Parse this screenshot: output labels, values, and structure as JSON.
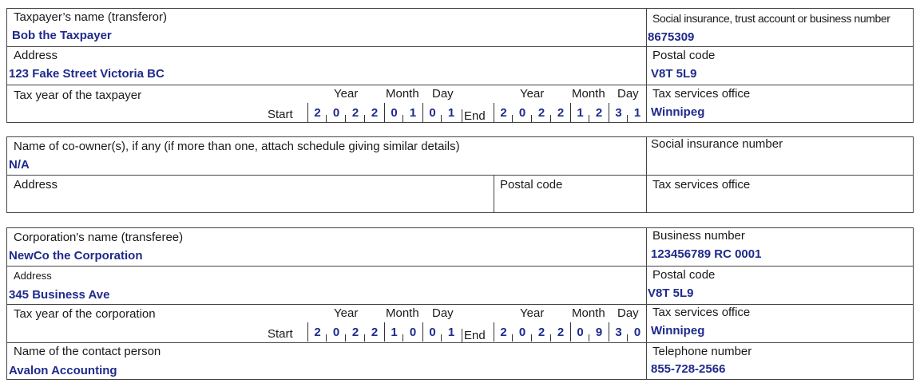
{
  "transferor": {
    "name_label": "Taxpayer’s name (transferor)",
    "name_value": "Bob the Taxpayer",
    "number_label": "Social insurance, trust account or business number",
    "number_value": "8675309",
    "address_label": "Address",
    "address_value": "123 Fake Street Victoria BC",
    "postal_label": "Postal code",
    "postal_value": "V8T 5L9",
    "tax_year_label": "Tax year of the taxpayer",
    "tso_label": "Tax services office",
    "tso_value": "Winnipeg",
    "year_label": "Year",
    "month_label": "Month",
    "day_label": "Day",
    "start_label": "Start",
    "end_label": "End",
    "start_digits": [
      "2",
      "0",
      "2",
      "2",
      "0",
      "1",
      "0",
      "1"
    ],
    "end_digits": [
      "2",
      "0",
      "2",
      "2",
      "1",
      "2",
      "3",
      "1"
    ]
  },
  "coowner": {
    "name_label": "Name of co-owner(s), if any (if more than one, attach schedule giving similar details)",
    "name_value": "N/A",
    "sin_label": "Social insurance number",
    "address_label": "Address",
    "postal_label": "Postal code",
    "tso_label": "Tax services office"
  },
  "transferee": {
    "name_label": "Corporation's name (transferee)",
    "name_value": "NewCo the Corporation",
    "bn_label": "Business number",
    "bn_value": "123456789 RC 0001",
    "address_label": "Address",
    "address_value": "345 Business Ave",
    "postal_label": "Postal code",
    "postal_value": "V8T 5L9",
    "tax_year_label": "Tax year of the corporation",
    "tso_label": "Tax services office",
    "tso_value": "Winnipeg",
    "year_label": "Year",
    "month_label": "Month",
    "day_label": "Day",
    "start_label": "Start",
    "end_label": "End",
    "start_digits": [
      "2",
      "0",
      "2",
      "2",
      "1",
      "0",
      "0",
      "1"
    ],
    "end_digits": [
      "2",
      "0",
      "2",
      "2",
      "0",
      "9",
      "3",
      "0"
    ],
    "contact_label": "Name of the contact person",
    "contact_value": "Avalon Accounting",
    "phone_label": "Telephone number",
    "phone_value": "855-728-2566"
  }
}
